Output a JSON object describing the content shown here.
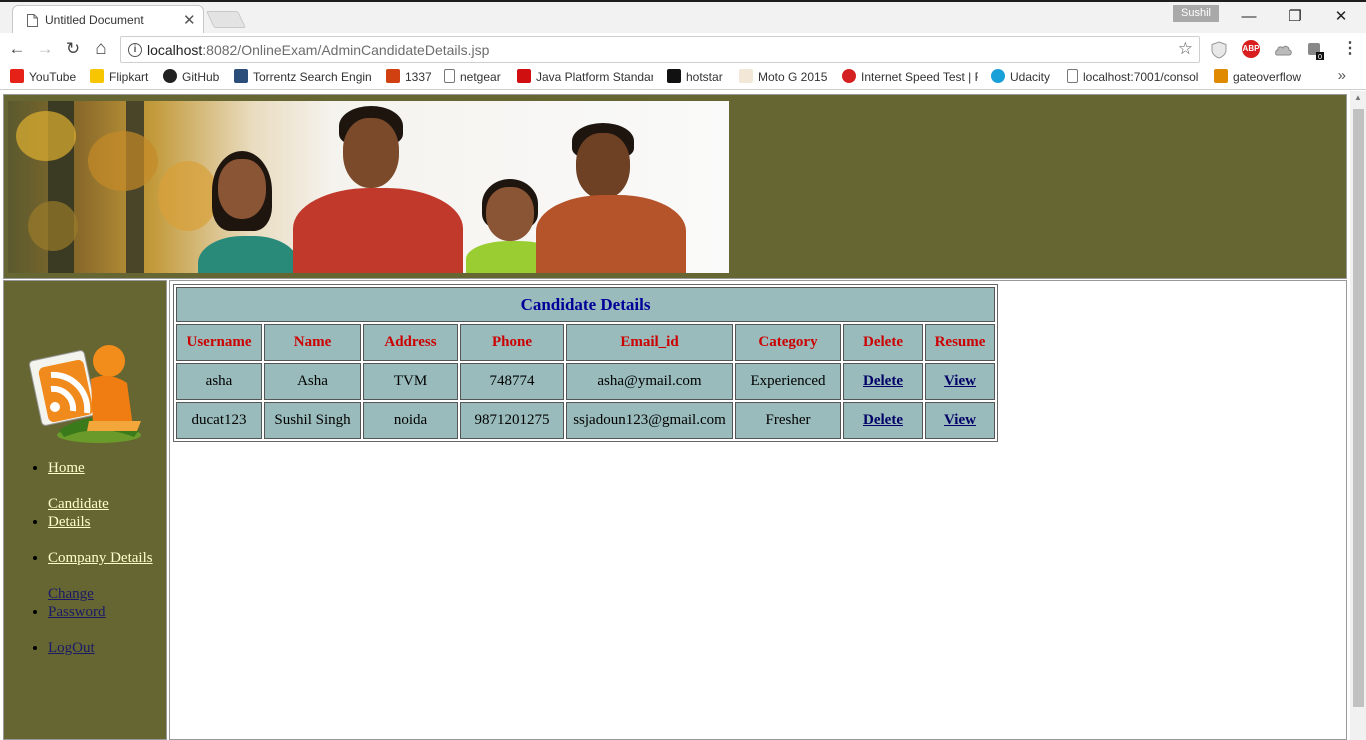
{
  "browser": {
    "tab_title": "Untitled Document",
    "tab_close": "✕",
    "profile_name": "Sushil",
    "window_controls": {
      "minimize": "—",
      "restore": "❐",
      "close": "✕"
    },
    "nav": {
      "back": "←",
      "forward": "→",
      "reload": "↻",
      "home": "⌂"
    },
    "url_host": "localhost",
    "url_path": ":8082/OnlineExam/AdminCandidateDetails.jsp",
    "bookmark_star": "☆",
    "extensions": [
      "shield-icon",
      "abp-icon",
      "cloud-icon",
      "puzzle-badge-icon"
    ],
    "abp_label": "ABP",
    "menu": "⋮",
    "bookmarks_more": "»",
    "bookmarks": [
      {
        "label": "YouTube",
        "icon": "youtube-icon",
        "color": "#e62117"
      },
      {
        "label": "Flipkart",
        "icon": "flipkart-icon",
        "color": "#f7c600"
      },
      {
        "label": "GitHub",
        "icon": "github-icon",
        "color": "#222222"
      },
      {
        "label": "Torrentz Search Engin",
        "icon": "torrentz-icon",
        "color": "#2a4d7a"
      },
      {
        "label": "1337",
        "icon": "x-icon",
        "color": "#d14010"
      },
      {
        "label": "netgear",
        "icon": "page-icon",
        "color": "#ffffff"
      },
      {
        "label": "Java Platform Standar",
        "icon": "oracle-icon",
        "color": "#d01010"
      },
      {
        "label": "hotstar",
        "icon": "hotstar-icon",
        "color": "#111111"
      },
      {
        "label": "Moto G 2015",
        "icon": "xda-icon",
        "color": "#f3e8d8"
      },
      {
        "label": "Internet Speed Test | F",
        "icon": "speed-icon",
        "color": "#d42020"
      },
      {
        "label": "Udacity",
        "icon": "udacity-icon",
        "color": "#1aa0d8"
      },
      {
        "label": "localhost:7001/consol",
        "icon": "page-icon",
        "color": "#ffffff"
      },
      {
        "label": "gateoverflow",
        "icon": "gateoverflow-icon",
        "color": "#e08a00"
      }
    ]
  },
  "colors": {
    "panel_bg": "#666633",
    "table_cell_bg": "#99bbbb",
    "title_text": "#000099",
    "header_text": "#cc0000",
    "nav_link": "#ffffcc",
    "nav_link_visited": "#1a1a66"
  },
  "sidebar": {
    "items": [
      {
        "label": "Home",
        "visited": false
      },
      {
        "label": "Candidate Details",
        "visited": false
      },
      {
        "label": "Company Details",
        "visited": false
      },
      {
        "label": "Change Password",
        "visited": true
      },
      {
        "label": "LogOut",
        "visited": true
      }
    ]
  },
  "table": {
    "title": "Candidate Details",
    "headers": [
      "Username",
      "Name",
      "Address",
      "Phone",
      "Email_id",
      "Category",
      "Delete",
      "Resume"
    ],
    "rows": [
      {
        "username": "asha",
        "name": "Asha",
        "address": "TVM",
        "phone": "748774",
        "email": "asha@ymail.com",
        "category": "Experienced",
        "delete": "Delete",
        "resume": "View"
      },
      {
        "username": "ducat123",
        "name": "Sushil Singh",
        "address": "noida",
        "phone": "9871201275",
        "email": "ssjadoun123@gmail.com",
        "category": "Fresher",
        "delete": "Delete",
        "resume": "View"
      }
    ]
  }
}
